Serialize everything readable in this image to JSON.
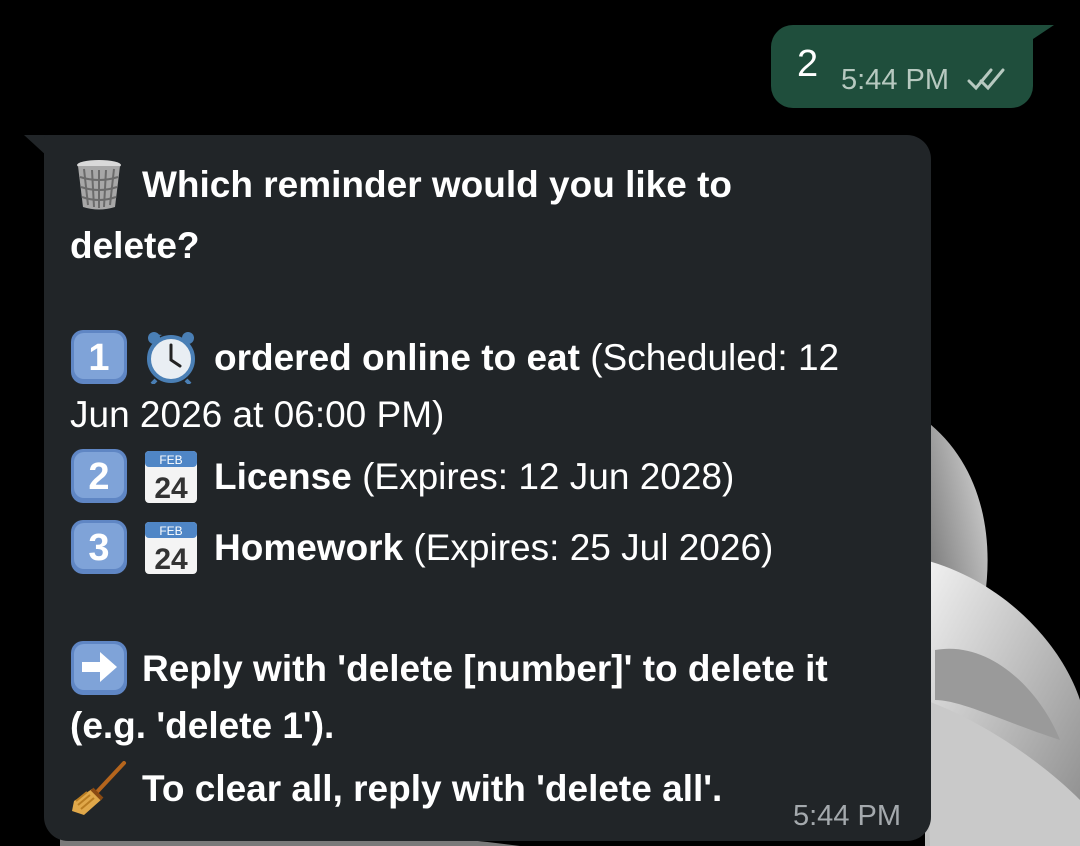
{
  "outgoing_message": {
    "text": "2",
    "time": "5:44 PM",
    "status": "read-double-check-icon"
  },
  "incoming_message": {
    "heading": "Which reminder would you like to",
    "heading_cont": "delete?",
    "items": [
      {
        "number": "1",
        "icon": "alarm-clock-icon",
        "title": "ordered online to eat",
        "detail": " (Scheduled: 12",
        "detail_cont": "Jun 2026 at 06:00 PM)"
      },
      {
        "number": "2",
        "icon": "calendar-icon",
        "title": "License",
        "detail": " (Expires: 12 Jun 2028)"
      },
      {
        "number": "3",
        "icon": "calendar-icon",
        "title": "Homework",
        "detail": " (Expires: 25 Jul 2026)"
      }
    ],
    "instruction": "Reply with 'delete [number]' to delete it",
    "instruction_cont": "(e.g. 'delete 1').",
    "clear_all": "To clear all, reply with 'delete all'.",
    "time": "5:44 PM",
    "calendar_month": "FEB",
    "calendar_day": "24"
  },
  "colors": {
    "outgoing_bubble": "#1f4e3c",
    "incoming_bubble": "#212528",
    "background": "#000000"
  }
}
